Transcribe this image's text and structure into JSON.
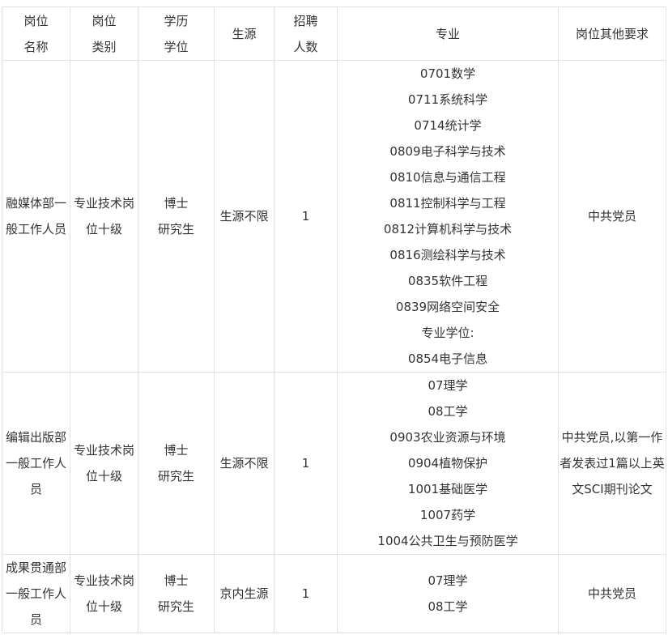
{
  "header": {
    "name": [
      "岗位",
      "名称"
    ],
    "category": [
      "岗位",
      "类别"
    ],
    "degree": [
      "学历",
      "学位"
    ],
    "source": "生源",
    "count": [
      "招聘",
      "人数"
    ],
    "major": "专业",
    "other": "岗位其他要求"
  },
  "rows": [
    {
      "name": "融媒体部一般工作人员",
      "category": "专业技术岗位十级",
      "degree": [
        "博士",
        "研究生"
      ],
      "source": "生源不限",
      "count": "1",
      "majors": [
        "0701数学",
        "0711系统科学",
        "0714统计学",
        "0809电子科学与技术",
        "0810信息与通信工程",
        "0811控制科学与工程",
        "0812计算机科学与技术",
        "0816测绘科学与技术",
        "0835软件工程",
        "0839网络空间安全",
        "专业学位:",
        "0854电子信息"
      ],
      "other": "中共党员"
    },
    {
      "name": "编辑出版部一般工作人员",
      "category": "专业技术岗位十级",
      "degree": [
        "博士",
        "研究生"
      ],
      "source": "生源不限",
      "count": "1",
      "majors": [
        "07理学",
        "08工学",
        "0903农业资源与环境",
        "0904植物保护",
        "1001基础医学",
        "1007药学",
        "1004公共卫生与预防医学"
      ],
      "other": "中共党员,以第一作者发表过1篇以上英文SCI期刊论文"
    },
    {
      "name": "成果贯通部一般工作人员",
      "category": "专业技术岗位十级",
      "degree": [
        "博士",
        "研究生"
      ],
      "source": "京内生源",
      "count": "1",
      "majors": [
        "07理学",
        "08工学"
      ],
      "other": "中共党员"
    }
  ]
}
